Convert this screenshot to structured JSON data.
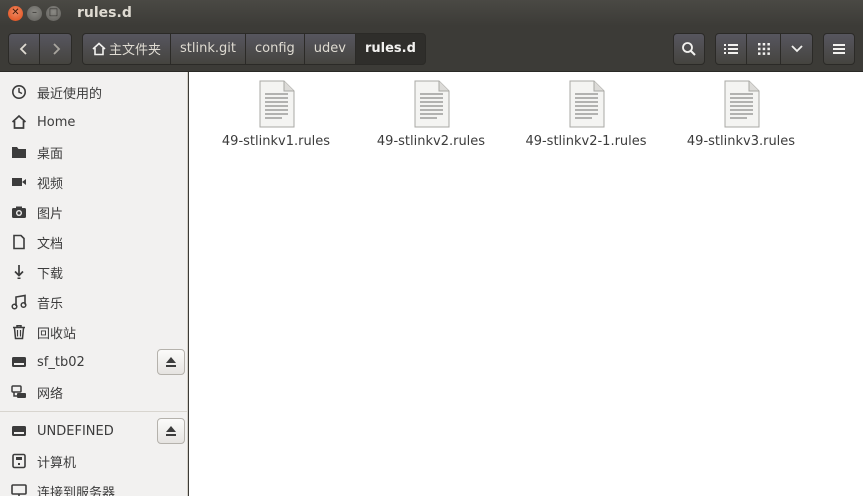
{
  "window": {
    "title": "rules.d"
  },
  "breadcrumbs": [
    {
      "label": "主文件夹",
      "icon": "home-icon"
    },
    {
      "label": "stlink.git"
    },
    {
      "label": "config"
    },
    {
      "label": "udev"
    },
    {
      "label": "rules.d",
      "active": true
    }
  ],
  "sidebar": {
    "items": [
      {
        "label": "最近使用的",
        "icon": "clock-icon"
      },
      {
        "label": "Home",
        "icon": "home-icon"
      },
      {
        "label": "桌面",
        "icon": "folder-icon"
      },
      {
        "label": "视频",
        "icon": "video-icon"
      },
      {
        "label": "图片",
        "icon": "camera-icon"
      },
      {
        "label": "文档",
        "icon": "document-icon"
      },
      {
        "label": "下载",
        "icon": "download-icon"
      },
      {
        "label": "音乐",
        "icon": "music-icon"
      },
      {
        "label": "回收站",
        "icon": "trash-icon"
      },
      {
        "label": "sf_tb02",
        "icon": "drive-icon",
        "eject": true
      },
      {
        "label": "网络",
        "icon": "network-icon"
      },
      {
        "label": "UNDEFINED",
        "icon": "drive-icon",
        "eject": true
      },
      {
        "label": "计算机",
        "icon": "computer-icon"
      },
      {
        "label": "连接到服务器",
        "icon": "server-icon"
      }
    ]
  },
  "files": [
    {
      "name": "49-stlinkv1.rules"
    },
    {
      "name": "49-stlinkv2.rules"
    },
    {
      "name": "49-stlinkv2-1.rules"
    },
    {
      "name": "49-stlinkv3.rules"
    }
  ],
  "colors": {
    "accent": "#df4a16",
    "toolbar": "#3c3b37",
    "sidebar": "#f2f1f0"
  }
}
